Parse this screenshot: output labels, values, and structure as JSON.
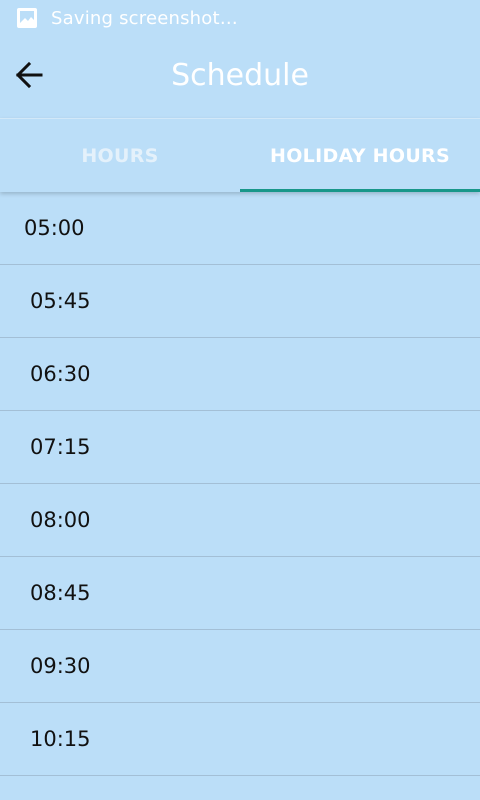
{
  "status_bar": {
    "icon": "image-icon",
    "text": "Saving screenshot…"
  },
  "app_bar": {
    "back_icon": "arrow-left-icon",
    "title": "Schedule"
  },
  "tabs": [
    {
      "label": "HOURS",
      "active": false
    },
    {
      "label": "HOLIDAY HOURS",
      "active": true
    }
  ],
  "times": [
    "05:00",
    "05:45",
    "06:30",
    "07:15",
    "08:00",
    "08:45",
    "09:30",
    "10:15"
  ],
  "colors": {
    "background": "#bbdef8",
    "tab_indicator": "#18978a"
  }
}
